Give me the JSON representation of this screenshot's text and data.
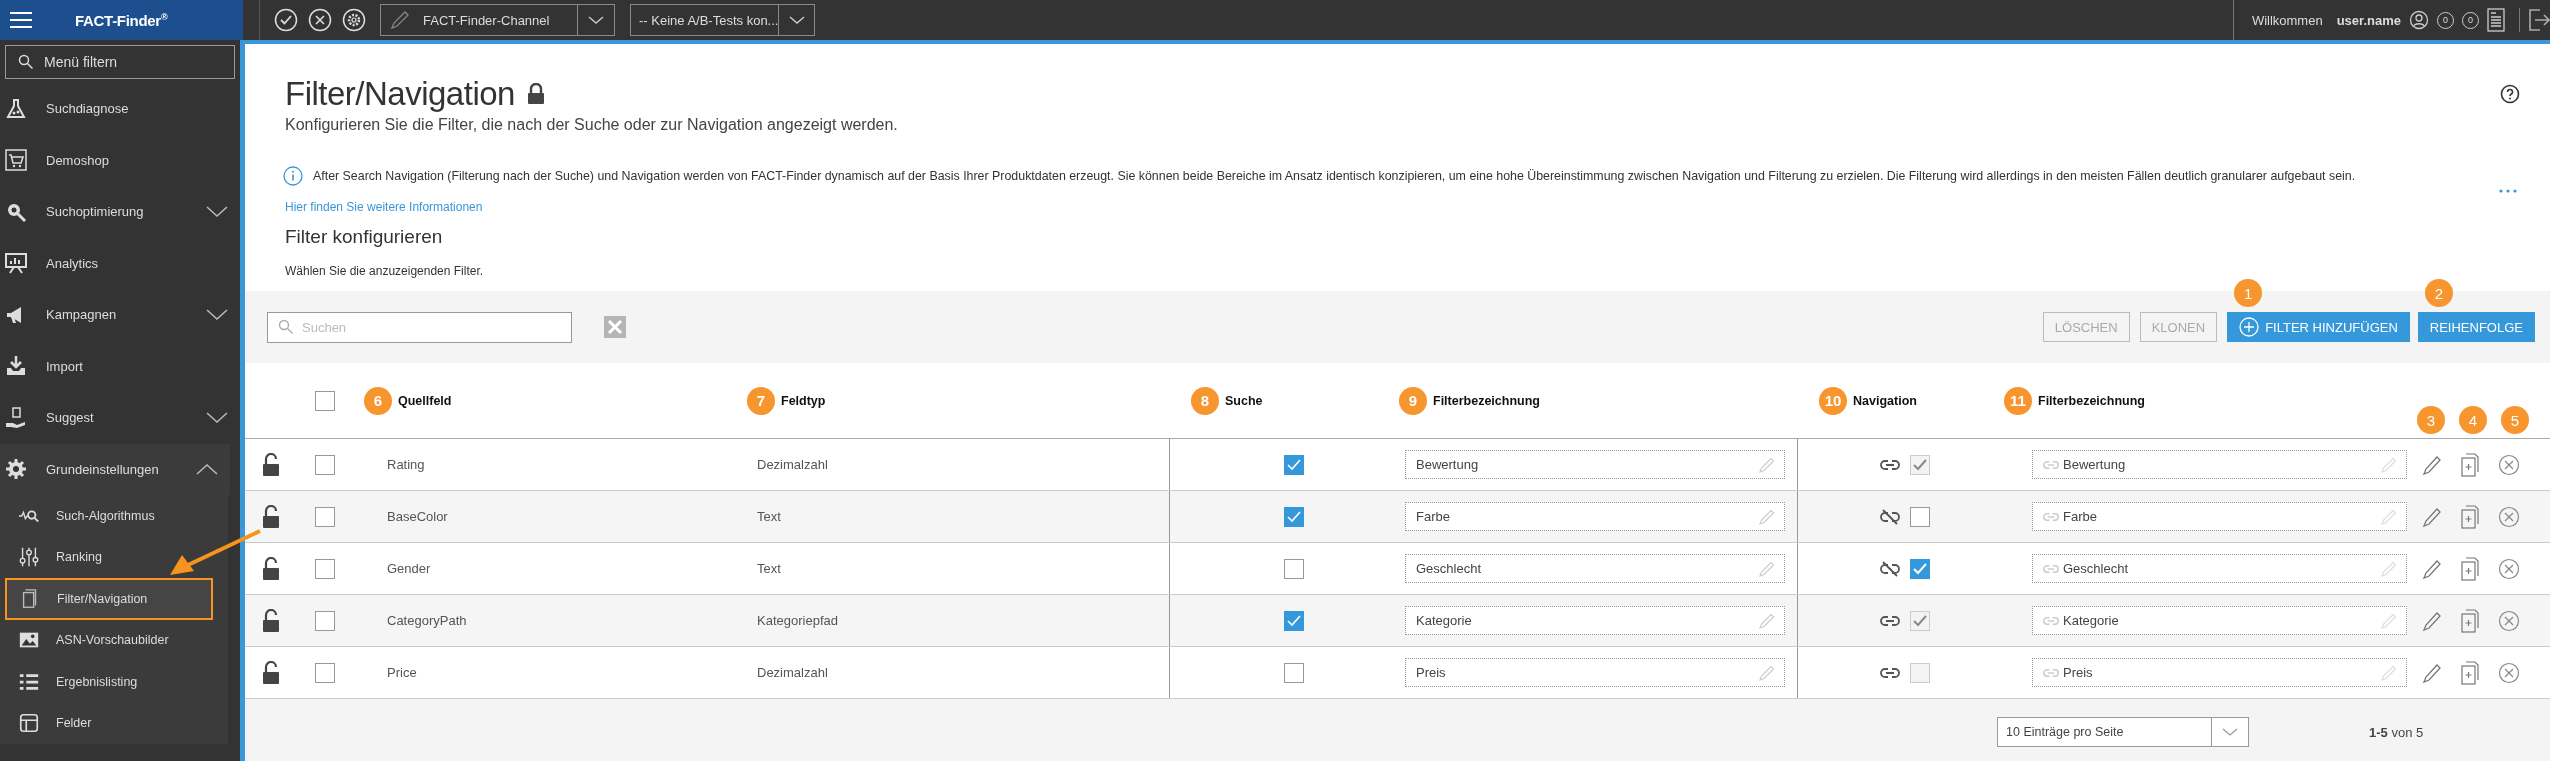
{
  "topbar": {
    "logo": "FACT-Finder$^{®}$",
    "channel": "FACT-Finder-Channel",
    "ab_test": "-- Keine A/B-Tests kon...",
    "welcome": "Willkommen",
    "user": "user.name",
    "counters": [
      "0",
      "0"
    ]
  },
  "sidebar": {
    "filter_placeholder": "Menü filtern",
    "items": [
      {
        "label": "Suchdiagnose"
      },
      {
        "label": "Demoshop"
      },
      {
        "label": "Suchoptimierung",
        "expanded": false
      },
      {
        "label": "Analytics"
      },
      {
        "label": "Kampagnen",
        "expanded": false
      },
      {
        "label": "Import"
      },
      {
        "label": "Suggest",
        "expanded": false
      },
      {
        "label": "Grundeinstellungen",
        "expanded": true,
        "children": [
          {
            "label": "Such-Algorithmus",
            "selected": false,
            "highlighted": false
          },
          {
            "label": "Ranking",
            "selected": false,
            "highlighted": false
          },
          {
            "label": "Filter/Navigation",
            "selected": true,
            "highlighted": true
          },
          {
            "label": "ASN-Vorschaubilder",
            "selected": false,
            "highlighted": false
          },
          {
            "label": "Ergebnislisting",
            "selected": false,
            "highlighted": false
          },
          {
            "label": "Felder",
            "selected": false,
            "highlighted": false
          }
        ]
      }
    ]
  },
  "page": {
    "title": "Filter/Navigation",
    "subtitle": "Konfigurieren Sie die Filter, die nach der Suche oder zur Navigation angezeigt werden.",
    "info": "After Search Navigation (Filterung nach der Suche) und Navigation werden von FACT-Finder dynamisch auf der Basis Ihrer Produktdaten erzeugt. Sie können beide Bereiche im Ansatz identisch konzipieren, um eine hohe Übereinstimmung zwischen Navigation und Filterung zu erzielen. Die Filterung wird allerdings in den meisten Fällen deutlich granularer aufgebaut sein.",
    "link": "Hier finden Sie weitere Informationen",
    "section_title": "Filter konfigurieren",
    "section_hint": "Wählen Sie die anzuzeigenden Filter."
  },
  "toolbar": {
    "search_placeholder": "Suchen",
    "buttons": [
      {
        "label": "LÖSCHEN",
        "disabled": true
      },
      {
        "label": "KLONEN",
        "disabled": true
      },
      {
        "label": "FILTER HINZUFÜGEN",
        "disabled": false,
        "kind": "add",
        "badge": "1"
      },
      {
        "label": "REIHENFOLGE",
        "disabled": false,
        "kind": "plain",
        "badge": "2"
      }
    ]
  },
  "table": {
    "select_all_checked": false,
    "columns": [
      {
        "label": "Quellfeld",
        "badge": "6"
      },
      {
        "label": "Feldtyp",
        "badge": "7"
      },
      {
        "label": "Suche",
        "badge": "8"
      },
      {
        "label": "Filterbezeichnung",
        "badge": "9"
      },
      {
        "label": "Navigation",
        "badge": "10"
      },
      {
        "label": "Filterbezeichnung",
        "badge": "11"
      }
    ],
    "action_badges": [
      "3",
      "4",
      "5"
    ],
    "rows": [
      {
        "checked": false,
        "source": "Rating",
        "type": "Dezimalzahl",
        "search": true,
        "filter_name": "Bewertung",
        "nav_linked": true,
        "nav_checked": true,
        "nav_disabled": true,
        "nav_filter_name": "Bewertung"
      },
      {
        "checked": false,
        "source": "BaseColor",
        "type": "Text",
        "search": true,
        "filter_name": "Farbe",
        "nav_linked": false,
        "nav_checked": false,
        "nav_disabled": false,
        "nav_filter_name": "Farbe"
      },
      {
        "checked": false,
        "source": "Gender",
        "type": "Text",
        "search": false,
        "filter_name": "Geschlecht",
        "nav_linked": false,
        "nav_checked": true,
        "nav_disabled": false,
        "nav_filter_name": "Geschlecht"
      },
      {
        "checked": false,
        "source": "CategoryPath",
        "type": "Kategoriepfad",
        "search": true,
        "filter_name": "Kategorie",
        "nav_linked": true,
        "nav_checked": true,
        "nav_disabled": true,
        "nav_filter_name": "Kategorie"
      },
      {
        "checked": false,
        "source": "Price",
        "type": "Dezimalzahl",
        "search": false,
        "filter_name": "Preis",
        "nav_linked": true,
        "nav_checked": false,
        "nav_disabled": true,
        "nav_filter_name": "Preis"
      }
    ]
  },
  "pagination": {
    "per_page": "10 Einträge pro Seite",
    "range": "**1-5** von 5"
  }
}
